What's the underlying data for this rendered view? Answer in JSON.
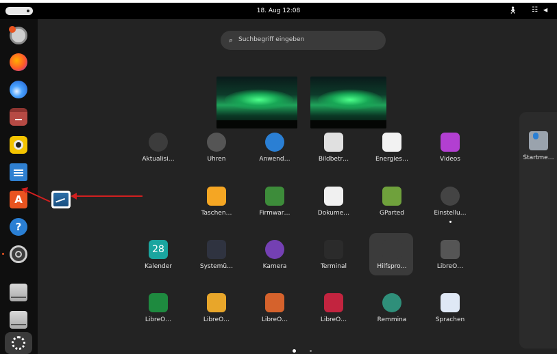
{
  "topbar": {
    "clock": "18. Aug  12:08",
    "icons": [
      "accessibility-icon",
      "network-icon",
      "volume-icon"
    ]
  },
  "dock": {
    "items": [
      {
        "name": "disk-utility",
        "color": "#b3b3b3"
      },
      {
        "name": "firefox",
        "color": "#ff7139"
      },
      {
        "name": "thunderbird",
        "color": "#1c6fd8"
      },
      {
        "name": "files",
        "color": "#a8413e"
      },
      {
        "name": "rhythmbox",
        "color": "#f0c000"
      },
      {
        "name": "libreoffice-writer",
        "color": "#2a76c7"
      },
      {
        "name": "app-center",
        "color": "#e95420"
      },
      {
        "name": "help",
        "color": "#2a7fd4"
      },
      {
        "name": "settings",
        "color": "#5a5a5a"
      },
      {
        "name": "drive-1",
        "color": "#bdbdbd"
      },
      {
        "name": "drive-2",
        "color": "#bdbdbd"
      },
      {
        "name": "show-apps",
        "color": "#3a3a3a"
      }
    ]
  },
  "search": {
    "placeholder": "Suchbegriff eingeben"
  },
  "apps": [
    {
      "label": "Aktualisi…",
      "icon": "software-updater-icon",
      "color": "#3c3c3c"
    },
    {
      "label": "Uhren",
      "icon": "clock-icon",
      "color": "#555555"
    },
    {
      "label": "Anwend…",
      "icon": "app-store-icon",
      "color": "#2a7fd4"
    },
    {
      "label": "Bildbetr…",
      "icon": "image-viewer-icon",
      "color": "#e0e0e0"
    },
    {
      "label": "Energies…",
      "icon": "power-stats-icon",
      "color": "#f2f2f2"
    },
    {
      "label": "Videos",
      "icon": "video-icon",
      "color": "#b23fd1"
    },
    {
      "label": "Taschen…",
      "icon": "calculator-icon",
      "color": "#f5a623"
    },
    {
      "label": "Firmwar…",
      "icon": "firmware-icon",
      "color": "#3d8c3a"
    },
    {
      "label": "Dokume…",
      "icon": "document-viewer-icon",
      "color": "#f0f0f0"
    },
    {
      "label": "GParted",
      "icon": "gparted-icon",
      "color": "#6fa13c"
    },
    {
      "label": "Einstellu…",
      "icon": "settings-icon",
      "color": "#444444"
    },
    {
      "label": "Kalender",
      "icon": "calendar-icon",
      "color": "#1aa59f"
    },
    {
      "label": "Systemü…",
      "icon": "system-monitor-icon",
      "color": "#2f3340"
    },
    {
      "label": "Kamera",
      "icon": "camera-icon",
      "color": "#7440b3"
    },
    {
      "label": "Terminal",
      "icon": "terminal-icon",
      "color": "#2b2b2b"
    },
    {
      "label": "Hilfspro…",
      "icon": "utilities-folder-icon",
      "color": "#3b3b3b"
    },
    {
      "label": "LibreO…",
      "icon": "libreoffice-icon",
      "color": "#555555"
    },
    {
      "label": "LibreO…",
      "icon": "libreoffice-calc-icon",
      "color": "#1e8a3f"
    },
    {
      "label": "LibreO…",
      "icon": "libreoffice-draw-icon",
      "color": "#e8a62a"
    },
    {
      "label": "LibreO…",
      "icon": "libreoffice-impress-icon",
      "color": "#d5622c"
    },
    {
      "label": "LibreO…",
      "icon": "libreoffice-math-icon",
      "color": "#c2243f"
    },
    {
      "label": "Remmina",
      "icon": "remmina-icon",
      "color": "#2f8f7a"
    },
    {
      "label": "Sprachen",
      "icon": "language-icon",
      "color": "#dfe8f5"
    }
  ],
  "calendar_day": "28",
  "side_app": {
    "label": "Startme…",
    "icon": "startup-disk-icon",
    "color": "#9aa3ad"
  },
  "pager": {
    "pages": 2,
    "current": 1
  }
}
